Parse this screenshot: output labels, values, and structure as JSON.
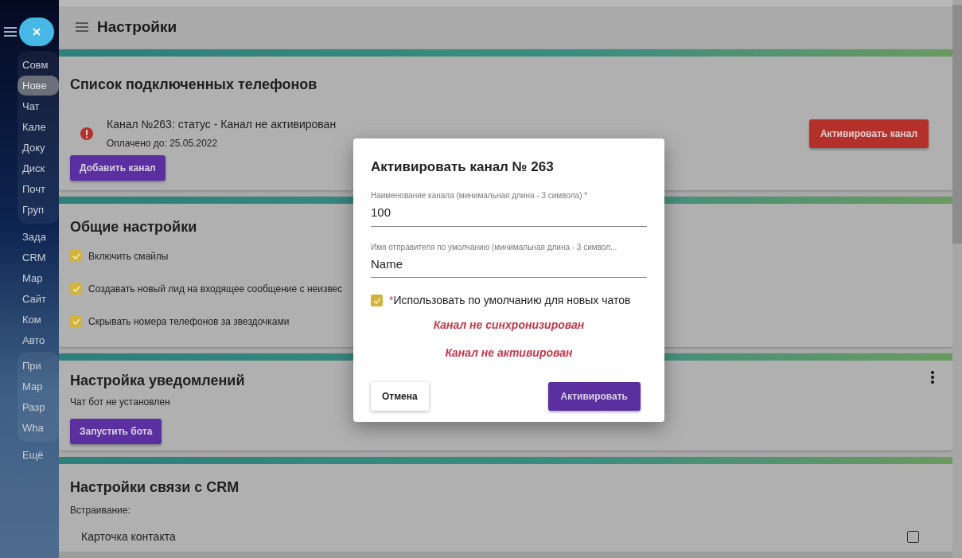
{
  "header": {
    "title": "Настройки"
  },
  "sidebar": {
    "items": [
      {
        "label": "Совм",
        "selected": false
      },
      {
        "label": "Нове",
        "selected": true
      },
      {
        "label": "Чат",
        "selected": false
      },
      {
        "label": "Кале",
        "selected": false
      },
      {
        "label": "Доку",
        "selected": false
      },
      {
        "label": "Диск",
        "selected": false
      },
      {
        "label": "Почт",
        "selected": false
      },
      {
        "label": "Груп",
        "selected": false
      },
      {
        "label": "Зада",
        "selected": false
      },
      {
        "label": "CRM",
        "selected": false
      },
      {
        "label": "Мар",
        "selected": false
      },
      {
        "label": "Сайт",
        "selected": false
      },
      {
        "label": "Ком",
        "selected": false
      },
      {
        "label": "Авто",
        "selected": false
      },
      {
        "label": "При",
        "selected": false
      },
      {
        "label": "Мар",
        "selected": false
      },
      {
        "label": "Разр",
        "selected": false
      },
      {
        "label": "Wha",
        "selected": false
      },
      {
        "label": "Ещё",
        "selected": false
      }
    ]
  },
  "phones_card": {
    "title": "Список подключенных телефонов",
    "channels": [
      {
        "status": "Канал №263: статус - Канал не активирован",
        "paid": "Оплачено до: 25.05.2022",
        "action": "Активировать канал"
      }
    ],
    "add_button": "Добавить канал"
  },
  "general_card": {
    "title": "Общие настройки",
    "options": [
      {
        "label": "Включить смайлы",
        "checked": true
      },
      {
        "label": "Создавать новый лид на входящее сообщение с неизвес",
        "checked": true
      },
      {
        "label": "Скрывать номера телефонов за звездочками",
        "checked": true
      }
    ]
  },
  "notifications_card": {
    "title": "Настройка уведомлений",
    "text": "Чат бот не установлен",
    "button": "Запустить бота"
  },
  "crm_card": {
    "title": "Настройки связи с CRM",
    "label": "Встраивание:",
    "items": [
      {
        "label": "Карточка контакта",
        "checked": false
      }
    ]
  },
  "dialog": {
    "title": "Активировать канал № 263",
    "fields": [
      {
        "label": "Наименование канала (минимальная длина - 3 символа) *",
        "value": "100"
      },
      {
        "label": "Имя отправителя по умолчанию (минимальная длина - 3 символ...",
        "value": "Name"
      }
    ],
    "checkbox": {
      "required_mark": "*",
      "label": "Использовать по умолчанию для новых чатов",
      "checked": true
    },
    "messages": [
      "Канал не синхронизирован",
      "Канал не активирован"
    ],
    "cancel": "Отмена",
    "submit": "Активировать"
  }
}
